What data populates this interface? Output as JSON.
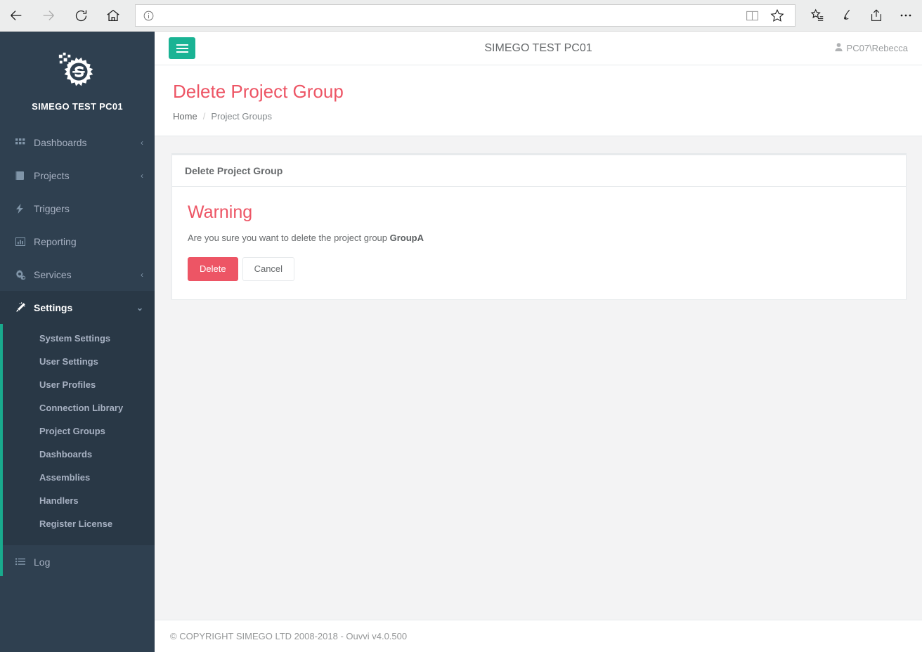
{
  "browser": {
    "back_icon": "arrow-left-icon",
    "forward_icon": "arrow-right-icon",
    "refresh_icon": "refresh-icon",
    "home_icon": "home-icon",
    "address_value": "",
    "address_placeholder": "",
    "info_icon": "info-icon",
    "reading_view_icon": "reading-view-icon",
    "favorite_icon": "star-icon",
    "hub_icon": "favorites-list-icon",
    "web_note_icon": "pen-icon",
    "share_icon": "share-icon",
    "more_icon": "more-icon"
  },
  "sidebar": {
    "brand_name": "SIMEGO TEST PC01",
    "logo_icon": "simego-gear-logo",
    "items": [
      {
        "label": "Dashboards",
        "icon": "grid-icon",
        "caret": "‹",
        "active": false
      },
      {
        "label": "Projects",
        "icon": "book-icon",
        "caret": "‹",
        "active": false
      },
      {
        "label": "Triggers",
        "icon": "bolt-icon",
        "caret": "",
        "active": false
      },
      {
        "label": "Reporting",
        "icon": "bar-chart-icon",
        "caret": "",
        "active": false
      },
      {
        "label": "Services",
        "icon": "gears-icon",
        "caret": "‹",
        "active": false
      },
      {
        "label": "Settings",
        "icon": "magic-wand-icon",
        "caret": "⌄",
        "active": true
      }
    ],
    "submenu": [
      "System Settings",
      "User Settings",
      "User Profiles",
      "Connection Library",
      "Project Groups",
      "Dashboards",
      "Assemblies",
      "Handlers",
      "Register License"
    ],
    "log_item": {
      "label": "Log",
      "icon": "list-icon"
    },
    "active_accent_color": "#19aa8d",
    "background_color": "#2f4050"
  },
  "topbar": {
    "menu_toggle_icon": "hamburger-icon",
    "title": "SIMEGO TEST PC01",
    "user_icon": "user-icon",
    "user_name": "PC07\\Rebecca"
  },
  "page": {
    "title": "Delete Project Group",
    "title_color": "#ed5565",
    "breadcrumb": {
      "home": "Home",
      "separator": "/",
      "current": "Project Groups"
    }
  },
  "panel": {
    "header": "Delete Project Group",
    "warning_title": "Warning",
    "warning_prefix": "Are you sure you want to delete the project group ",
    "group_name": "GroupA",
    "delete_label": "Delete",
    "cancel_label": "Cancel",
    "delete_color": "#ed5565"
  },
  "footer": {
    "copyright": "© COPYRIGHT SIMEGO LTD 2008-2018 - Ouvvi v4.0.500"
  }
}
